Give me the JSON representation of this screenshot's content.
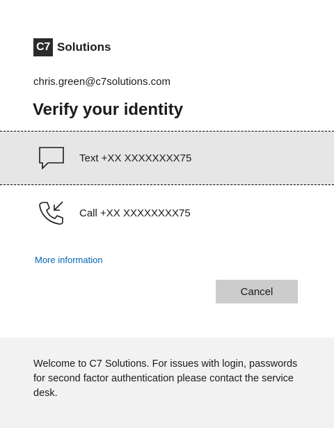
{
  "brand": {
    "logo_mark": "C7",
    "logo_text": "Solutions"
  },
  "account": {
    "email": "chris.green@c7solutions.com"
  },
  "title": "Verify your identity",
  "methods": [
    {
      "icon": "sms-chat-icon",
      "label": "Text +XX XXXXXXXX75",
      "selected": true
    },
    {
      "icon": "phone-call-icon",
      "label": "Call +XX XXXXXXXX75",
      "selected": false
    }
  ],
  "links": {
    "more_information": "More information"
  },
  "buttons": {
    "cancel": "Cancel"
  },
  "footer": {
    "text": "Welcome to C7 Solutions. For issues with login, passwords for second factor authentication please contact the service desk."
  },
  "colors": {
    "link": "#0067b8",
    "selected_bg": "#e6e6e6",
    "button_bg": "#cccccc",
    "footer_bg": "#f2f2f2"
  }
}
